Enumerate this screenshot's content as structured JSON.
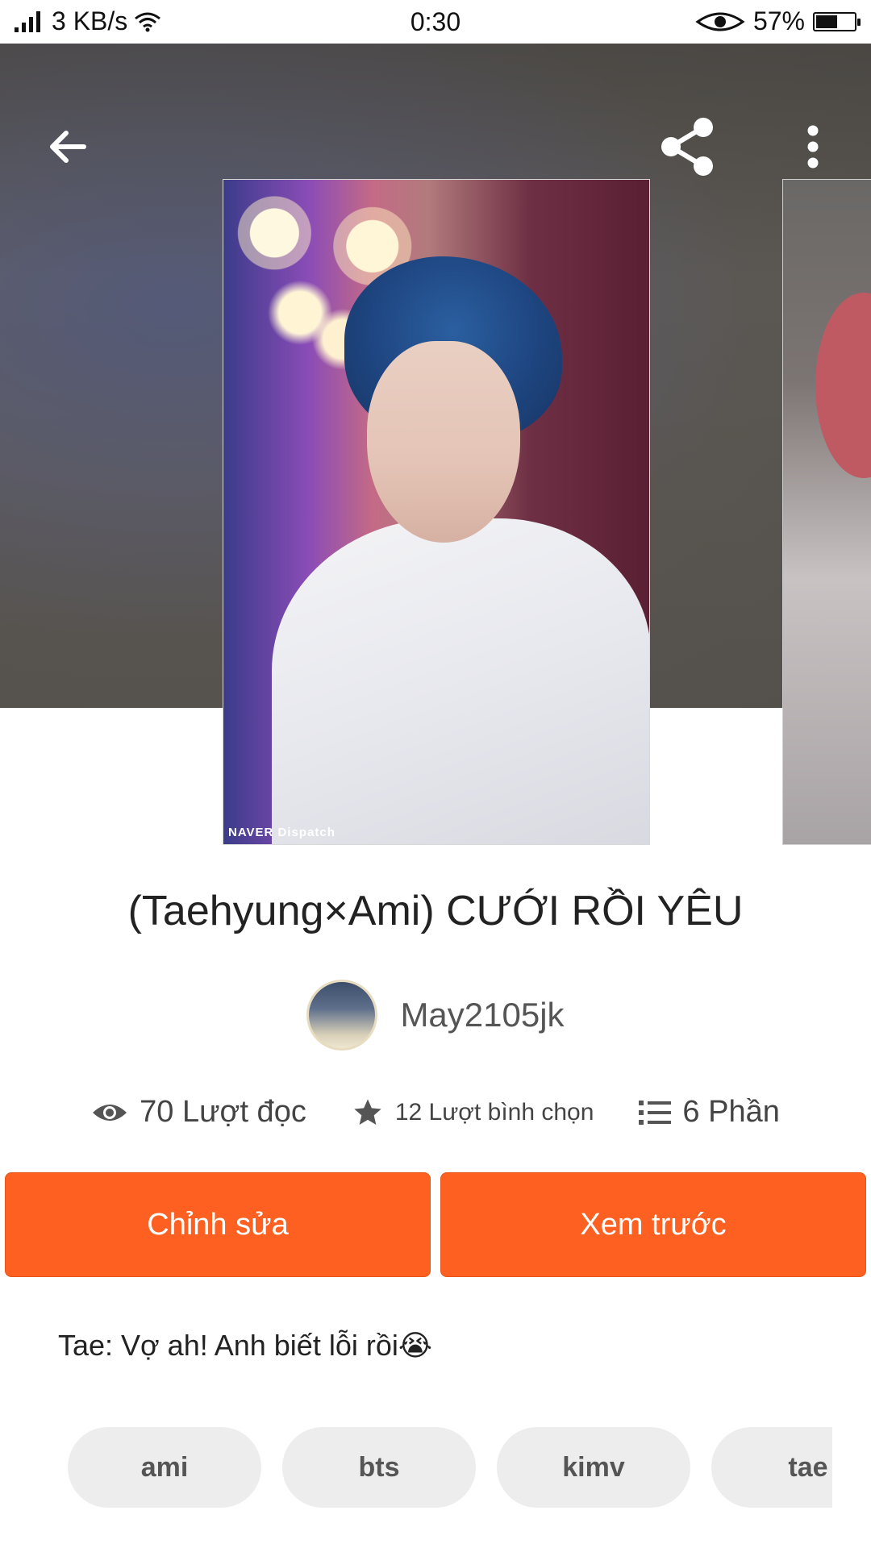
{
  "status_bar": {
    "net_speed": "3 KB/s",
    "time": "0:30",
    "battery": "57%",
    "battery_level": 0.57
  },
  "topbar": {
    "back_icon": "arrow-left-icon",
    "share_icon": "share-icon",
    "more_icon": "more-vertical-icon"
  },
  "cover": {
    "watermark": "NAVER Dispatch"
  },
  "story": {
    "title": "(Taehyung×Ami) CƯỚI RỒI YÊU",
    "author": "May2105jk",
    "reads": "70 Lượt đọc",
    "votes": "12 Lượt bình chọn",
    "parts": "6 Phần",
    "description": "Tae: Vợ ah! Anh biết lỗi rồi😭"
  },
  "actions": {
    "edit_label": "Chỉnh sửa",
    "preview_label": "Xem trước"
  },
  "tags": [
    {
      "label": "ami"
    },
    {
      "label": "bts"
    },
    {
      "label": "kimv"
    },
    {
      "label": "tae"
    }
  ],
  "colors": {
    "accent": "#fd6021",
    "tag_bg": "#ededed"
  }
}
